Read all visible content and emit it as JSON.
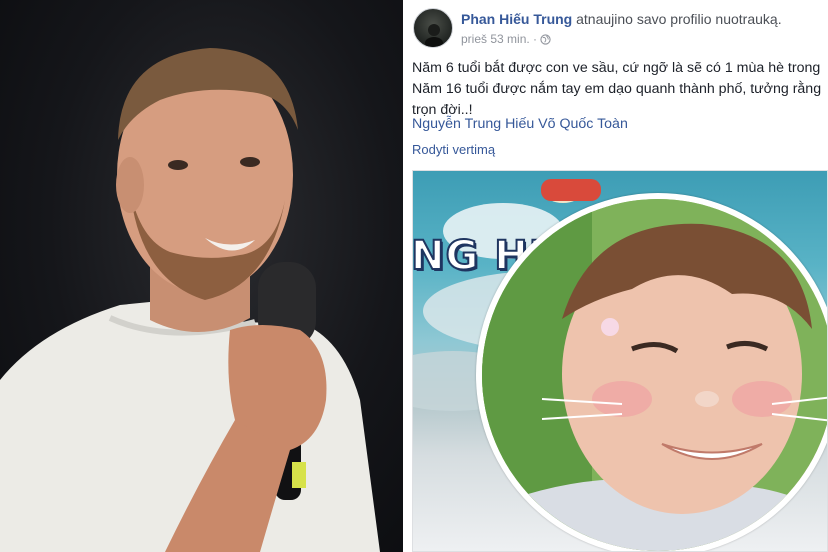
{
  "post": {
    "author_name": "Phan Hiếu Trung",
    "action_text": " atnaujino savo profilio nuotrauką.",
    "timestamp": "prieš 53 min. ·",
    "privacy_icon": "globe-icon",
    "text_lines": [
      "Năm 6 tuổi bắt được con ve sầu, cứ ngỡ là sẽ có 1 mùa hè trong",
      "Năm 16 tuổi được nắm tay em dạo quanh thành phố, tưởng rằng",
      "trọn đời..!"
    ],
    "tags": "Nguyễn Trung Hiếu Võ Quốc Toàn",
    "see_translation": "Rodyti vertimą",
    "cover_text": "NG HIE"
  },
  "colors": {
    "link": "#365899",
    "meta": "#90949c",
    "body_text": "#1d2129"
  }
}
